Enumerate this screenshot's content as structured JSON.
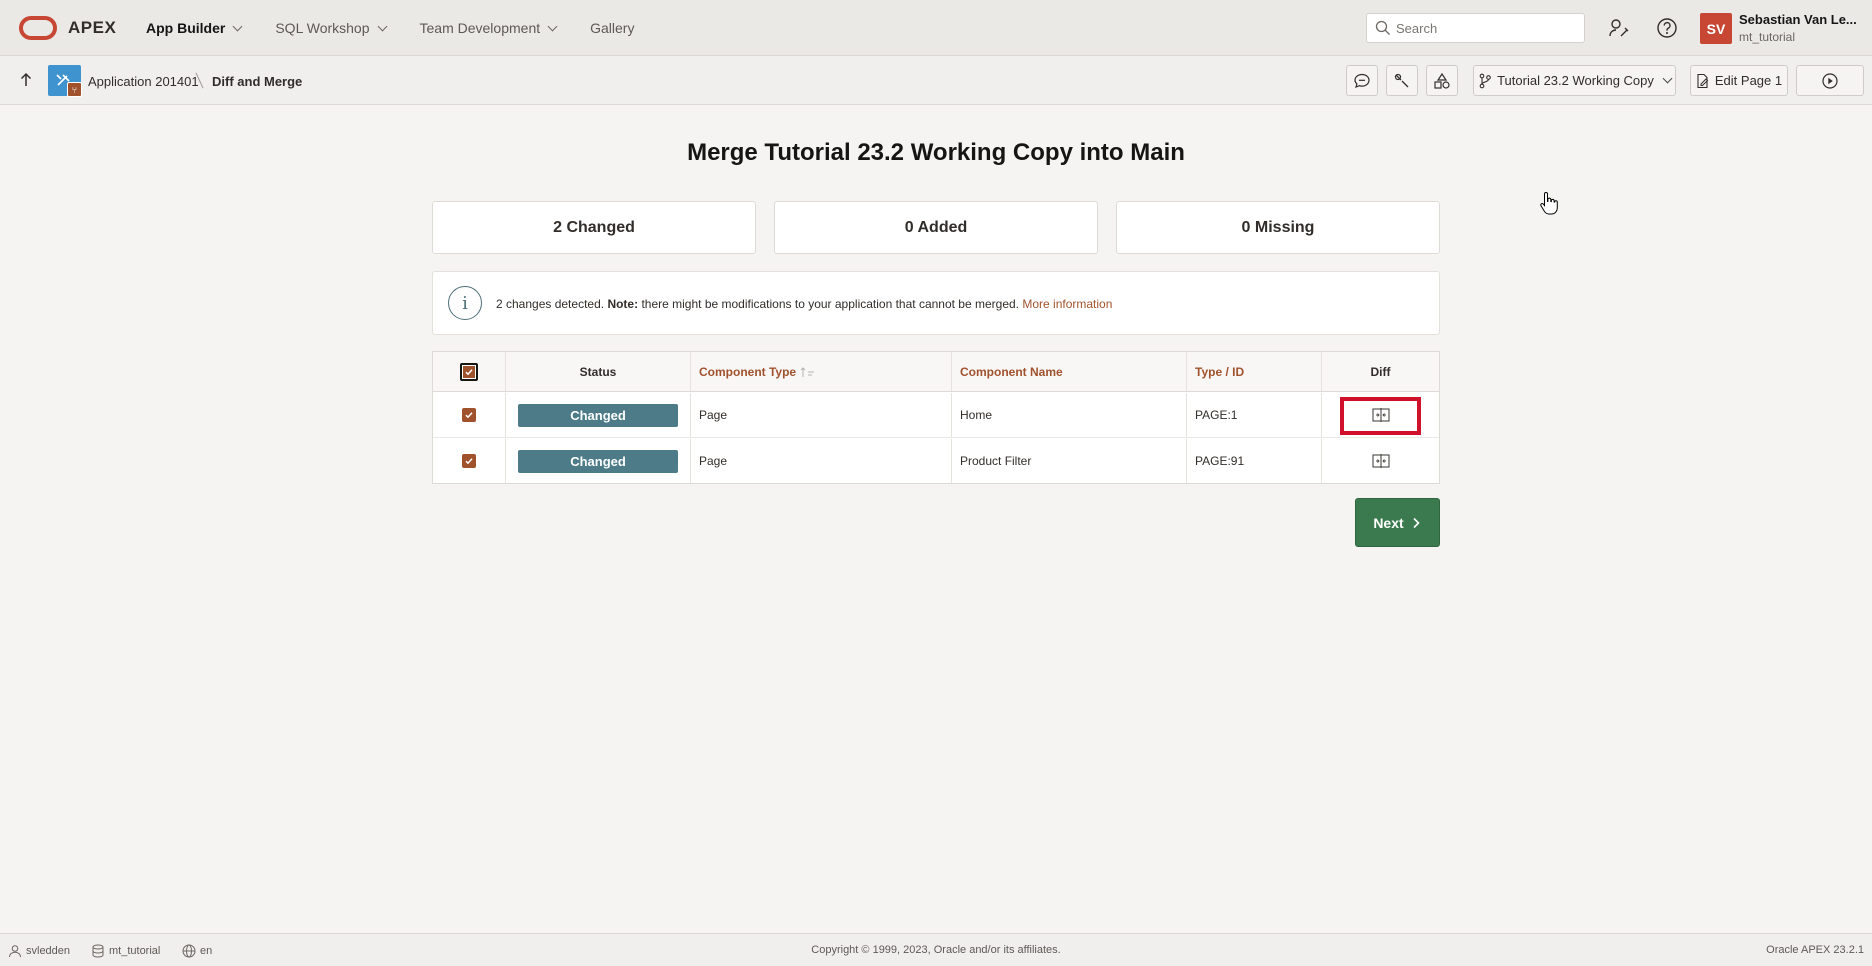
{
  "app": {
    "name": "APEX"
  },
  "topnav": {
    "items": [
      {
        "label": "App Builder",
        "has_menu": true
      },
      {
        "label": "SQL Workshop",
        "has_menu": true
      },
      {
        "label": "Team Development",
        "has_menu": true
      },
      {
        "label": "Gallery",
        "has_menu": false
      }
    ]
  },
  "search": {
    "placeholder": "Search"
  },
  "user": {
    "initials": "SV",
    "name": "Sebastian Van Le...",
    "workspace": "mt_tutorial"
  },
  "breadcrumb": {
    "app": "Application 201401",
    "current": "Diff and Merge"
  },
  "toolbar": {
    "branch_label": "Tutorial 23.2 Working Copy",
    "edit_page_label": "Edit Page 1"
  },
  "page": {
    "title": "Merge Tutorial 23.2 Working Copy into Main"
  },
  "stats": [
    {
      "label": "2 Changed"
    },
    {
      "label": "0 Added"
    },
    {
      "label": "0 Missing"
    }
  ],
  "info": {
    "lead": "2 changes detected.",
    "note_label": "Note:",
    "note_text": "there might be modifications to your application that cannot be merged.",
    "link": "More information"
  },
  "table": {
    "headers": {
      "status": "Status",
      "component_type": "Component Type",
      "component_name": "Component Name",
      "type_id": "Type / ID",
      "diff": "Diff"
    },
    "rows": [
      {
        "checked": true,
        "status": "Changed",
        "component_type": "Page",
        "component_name": "Home",
        "type_id": "PAGE:1"
      },
      {
        "checked": true,
        "status": "Changed",
        "component_type": "Page",
        "component_name": "Product Filter",
        "type_id": "PAGE:91"
      }
    ]
  },
  "next_button": {
    "label": "Next"
  },
  "footer": {
    "user": "svledden",
    "workspace": "mt_tutorial",
    "language": "en",
    "copyright": "Copyright © 1999, 2023, Oracle and/or its affiliates.",
    "version": "Oracle APEX 23.2.1"
  },
  "colors": {
    "accent": "#a0522d",
    "status_badge": "#4d7c88",
    "next_button": "#3b7a4e",
    "logo": "#c74634",
    "highlight": "#d0112b"
  }
}
